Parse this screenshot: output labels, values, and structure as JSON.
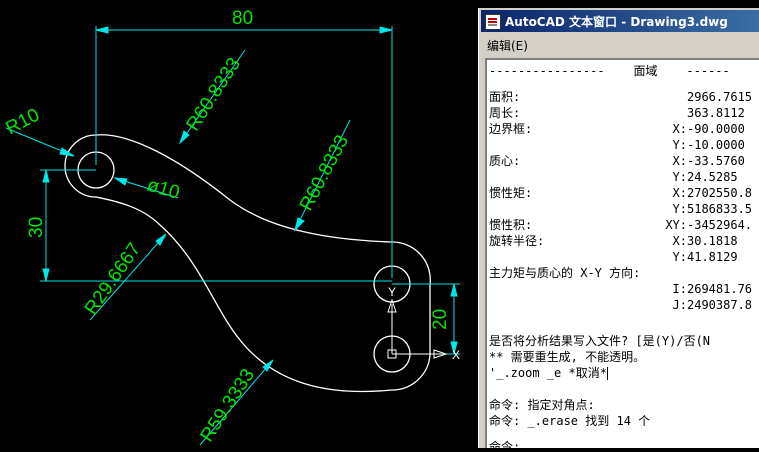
{
  "drawing": {
    "dimensions": {
      "top_width": "80",
      "radius_hole": "R10",
      "radius_upper_left": "R60.8333",
      "radius_upper_right": "R60.8333",
      "radius_inner": "R29.6667",
      "radius_lower": "R59.3333",
      "diameter": "ø10",
      "height_left": "30",
      "height_right": "20"
    },
    "ucs": {
      "y_label": "Y",
      "x_label": "X"
    },
    "colors": {
      "background": "#000000",
      "geometry": "#ffffff",
      "dimension_line": "#00e5e5",
      "dimension_text": "#00e600"
    }
  },
  "text_window": {
    "title": "AutoCAD 文本窗口 - Drawing3.dwg",
    "menu": {
      "edit": "编辑(E)"
    },
    "header": "----------------    面域    ------",
    "rows": [
      {
        "label": "面积:",
        "axis": "",
        "value": "2966.7615"
      },
      {
        "label": "周长:",
        "axis": "",
        "value": "363.8112"
      },
      {
        "label": "边界框:",
        "axis": "X:",
        "value": "-90.0000"
      },
      {
        "label": "",
        "axis": "Y:",
        "value": "-10.0000"
      },
      {
        "label": "质心:",
        "axis": "X:",
        "value": "-33.5760"
      },
      {
        "label": "",
        "axis": "Y:",
        "value": "24.5285"
      },
      {
        "label": "惯性矩:",
        "axis": "X:",
        "value": "2702550.8"
      },
      {
        "label": "",
        "axis": "Y:",
        "value": "5186833.5"
      },
      {
        "label": "惯性积:",
        "axis": "XY:",
        "value": "-3452964."
      },
      {
        "label": "旋转半径:",
        "axis": "X:",
        "value": "30.1818"
      },
      {
        "label": "",
        "axis": "Y:",
        "value": "41.8129"
      },
      {
        "label": "主力矩与质心的 X-Y 方向:",
        "axis": "",
        "value": ""
      },
      {
        "label": "",
        "axis": "I:",
        "value": "269481.76"
      },
      {
        "label": "",
        "axis": "J:",
        "value": "2490387.8"
      }
    ],
    "prompt_write": "是否将分析结果写入文件? [是(Y)/否(N",
    "regen_msg": "** 需要重生成, 不能透明。",
    "zoom_cmd": "'_.zoom _e *取消*",
    "cmd_corner": "命令: 指定对角点:",
    "cmd_erase": "命令: _.erase 找到 14 个",
    "cmd_last": "命令:"
  }
}
